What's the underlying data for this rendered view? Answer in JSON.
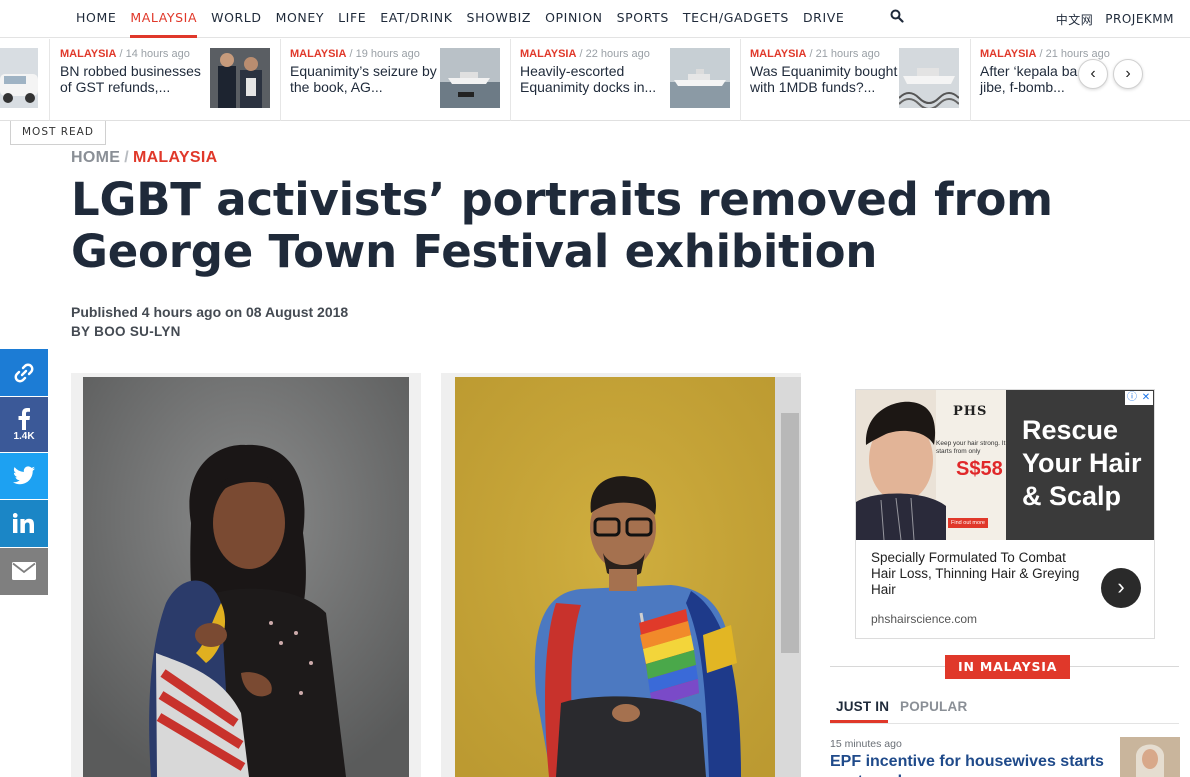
{
  "nav": {
    "items": [
      "HOME",
      "MALAYSIA",
      "WORLD",
      "MONEY",
      "LIFE",
      "EAT/DRINK",
      "SHOWBIZ",
      "OPINION",
      "SPORTS",
      "TECH/GADGETS",
      "DRIVE"
    ],
    "active": "MALAYSIA",
    "search_icon": "search-icon",
    "right": [
      "中文网",
      "PROJEKMM"
    ]
  },
  "ticker": {
    "items": [
      {
        "tag": "MALAYSIA",
        "time": " / 14 hours ago",
        "title": "BN robbed businesses of GST refunds,..."
      },
      {
        "tag": "MALAYSIA",
        "time": " / 19 hours ago",
        "title": "Equanimity’s seizure by the book, AG..."
      },
      {
        "tag": "MALAYSIA",
        "time": " / 22 hours ago",
        "title": "Heavily-escorted Equanimity docks in..."
      },
      {
        "tag": "MALAYSIA",
        "time": " / 21 hours ago",
        "title": "Was Equanimity bought with 1MDB funds?..."
      },
      {
        "tag": "MALAYSIA",
        "time": " / 21 hours ago",
        "title": "After ‘kepala ba... jibe, f-bomb..."
      }
    ],
    "prev": "‹",
    "next": "›",
    "most_read": "MOST READ"
  },
  "article": {
    "breadcrumb_home": "HOME",
    "breadcrumb_sep": "/",
    "breadcrumb_cat": "MALAYSIA",
    "headline": "LGBT activists’ portraits removed from George Town Festival exhibition",
    "published": "Published 4 hours ago on 08 August 2018",
    "byline": "BY BOO SU-LYN"
  },
  "share": {
    "facebook_count": "1.4K",
    "icons": [
      "link-icon",
      "facebook-icon",
      "twitter-icon",
      "linkedin-icon",
      "email-icon"
    ],
    "colors": {
      "link": "#1c7cd5",
      "facebook": "#3b5998",
      "twitter": "#1da1f2",
      "linkedin": "#1b86c6",
      "email": "#7f7f7f"
    }
  },
  "ad": {
    "brand": "PHS",
    "small_text": "Keep your hair strong. It starts from only",
    "price": "S$58",
    "find_out": "Find out more",
    "headline": "Rescue Your Hair & Scalp",
    "copy": "Specially Formulated To Combat Hair Loss, Thinning Hair & Greying Hair",
    "url": "phshairscience.com",
    "cta": "›"
  },
  "sidebar": {
    "section_label": "IN MALAYSIA",
    "tabs": [
      "JUST IN",
      "POPULAR"
    ],
    "active_tab": "JUST IN",
    "first_item": {
      "time": "15 minutes ago",
      "title": "EPF incentive for housewives starts next week"
    }
  },
  "colors": {
    "accent": "#e0382a",
    "text": "#1f2a3a"
  }
}
